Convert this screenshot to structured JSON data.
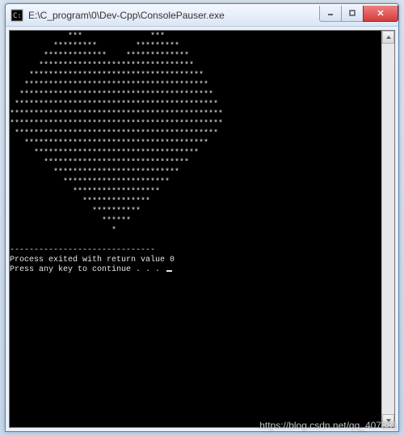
{
  "window": {
    "title": "E:\\C_program\\0\\Dev-Cpp\\ConsolePauser.exe"
  },
  "console": {
    "heart_lines": [
      "            ***              ***",
      "         *********        *********",
      "       *************    *************",
      "      ********************************",
      "    ************************************",
      "   **************************************",
      "  ****************************************",
      " ******************************************",
      "********************************************",
      "********************************************",
      " ******************************************",
      "   **************************************",
      "     **********************************",
      "       ******************************",
      "         **************************",
      "           **********************",
      "             ******************",
      "               **************",
      "                 **********",
      "                   ******",
      "                     *"
    ],
    "divider": "------------------------------",
    "exit_line": "Process exited with return value 0",
    "continue_line": "Press any key to continue . . ."
  },
  "watermark": "https://blog.csdn.net/qq_407881"
}
